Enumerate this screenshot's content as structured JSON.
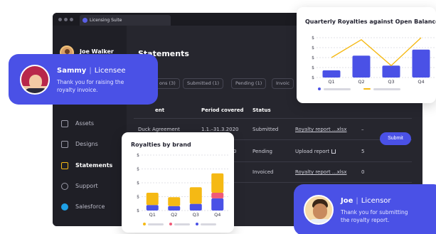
{
  "window": {
    "tab_title": "Licensing Suite"
  },
  "sidebar": {
    "user_name": "Joe Walker",
    "items": [
      {
        "label": "Assets",
        "icon": "image-icon"
      },
      {
        "label": "Designs",
        "icon": "layers-icon"
      },
      {
        "label": "Statements",
        "icon": "document-icon",
        "active": true
      },
      {
        "label": "Support",
        "icon": "headset-icon"
      },
      {
        "label": "Salesforce",
        "icon": "cloud-icon"
      }
    ]
  },
  "main": {
    "title": "Statements",
    "filters": [
      "ons (3)",
      "Submitted (1)",
      "Pending (1)",
      "Invoic"
    ],
    "columns": [
      "ent",
      "Period covered",
      "Status"
    ],
    "rows": [
      {
        "agreement": "Duck Agreement",
        "period": "1.1.–31.3.2020",
        "status": "Submitted",
        "report": "Royalty report ...xlsx",
        "count": "–"
      },
      {
        "agreement": "",
        "period": "0",
        "status": "Pending",
        "report": "Upload report",
        "count": "5",
        "action": "Submit"
      },
      {
        "agreement": "",
        "period": "",
        "status": "Invoiced",
        "report": "Royalty report ...xlsx",
        "count": "0"
      }
    ]
  },
  "messages": {
    "sammy": {
      "name": "Sammy",
      "role": "Licensee",
      "text": "Thank you for raising the\nroyalty invoice."
    },
    "joe": {
      "name": "Joe",
      "role": "Licensor",
      "text": "Thank you for submitting\nthe royalty report."
    }
  },
  "colors": {
    "accent": "#4a51e6",
    "yellow": "#f5b914",
    "pink": "#f05a78",
    "dark": "#26262e"
  },
  "chart_data": [
    {
      "type": "bar",
      "title": "Royalties by brand",
      "categories": [
        "Q1",
        "Q2",
        "Q3",
        "Q4"
      ],
      "y_tick_labels": [
        "$",
        "$",
        "$",
        "$",
        "$"
      ],
      "ylim": [
        0,
        100
      ],
      "series": [
        {
          "color": "#4a51e6",
          "values": [
            10,
            8,
            12,
            22
          ]
        },
        {
          "color": "#f05a78",
          "values": [
            0,
            0,
            0,
            10
          ]
        },
        {
          "color": "#f5b914",
          "values": [
            22,
            16,
            30,
            35
          ]
        }
      ]
    },
    {
      "type": "bar",
      "title": "Quarterly Royalties against Open Balance",
      "categories": [
        "Q1",
        "Q2",
        "Q3",
        "Q4"
      ],
      "y_tick_labels": [
        "$",
        "$",
        "$",
        "$",
        "$"
      ],
      "ylim": [
        0,
        100
      ],
      "series": [
        {
          "type": "bar",
          "color": "#4a51e6",
          "values": [
            18,
            55,
            30,
            70
          ]
        },
        {
          "type": "line",
          "color": "#f5b914",
          "values": [
            50,
            95,
            30,
            100
          ]
        }
      ]
    }
  ]
}
